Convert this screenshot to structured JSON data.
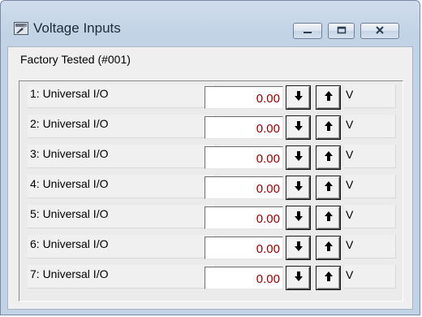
{
  "window": {
    "title": "Voltage Inputs",
    "subtitle": "Factory Tested (#001)",
    "controls": {
      "minimize": "minimize",
      "maximize": "maximize",
      "close": "close"
    }
  },
  "rows": [
    {
      "label": "1: Universal I/O",
      "value": "0.00",
      "unit": "V"
    },
    {
      "label": "2: Universal I/O",
      "value": "0.00",
      "unit": "V"
    },
    {
      "label": "3: Universal I/O",
      "value": "0.00",
      "unit": "V"
    },
    {
      "label": "4: Universal I/O",
      "value": "0.00",
      "unit": "V"
    },
    {
      "label": "5: Universal I/O",
      "value": "0.00",
      "unit": "V"
    },
    {
      "label": "6: Universal I/O",
      "value": "0.00",
      "unit": "V"
    },
    {
      "label": "7: Universal I/O",
      "value": "0.00",
      "unit": "V"
    }
  ],
  "colors": {
    "value_text": "#8b0000",
    "titlebar": "#c3d3e6"
  }
}
